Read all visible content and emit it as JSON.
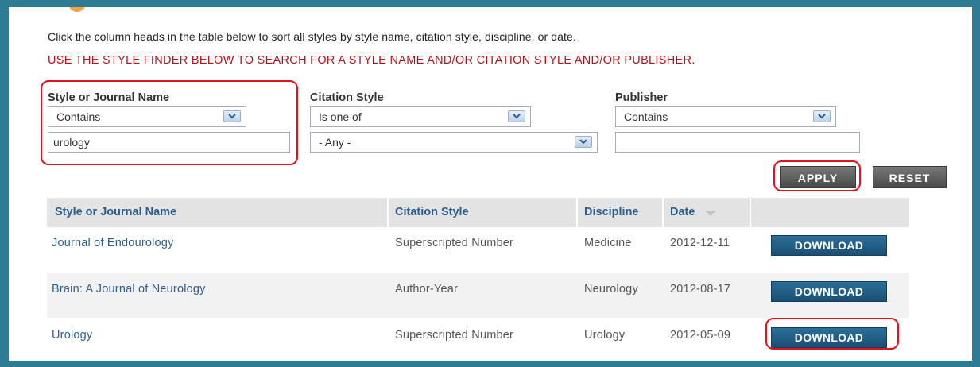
{
  "intro_text": "Click the column heads in the table below to sort all styles by style name, citation style, discipline, or date.",
  "finder_note": "USE THE STYLE FINDER BELOW TO SEARCH FOR A STYLE NAME AND/OR CITATION STYLE AND/OR PUBLISHER.",
  "filters": {
    "style_name": {
      "label": "Style or Journal Name",
      "operator": "Contains",
      "value": "urology"
    },
    "citation_style": {
      "label": "Citation Style",
      "operator": "Is one of",
      "value": "- Any -"
    },
    "publisher": {
      "label": "Publisher",
      "operator": "Contains",
      "value": ""
    }
  },
  "buttons": {
    "apply": "APPLY",
    "reset": "RESET"
  },
  "table": {
    "headers": [
      "Style or Journal Name",
      "Citation Style",
      "Discipline",
      "Date"
    ],
    "rows": [
      {
        "name": "Journal of Endourology",
        "citation": "Superscripted Number",
        "discipline": "Medicine",
        "date": "2012-12-11",
        "action": "DOWNLOAD"
      },
      {
        "name": "Brain: A Journal of Neurology",
        "citation": "Author-Year",
        "discipline": "Neurology",
        "date": "2012-08-17",
        "action": "DOWNLOAD"
      },
      {
        "name": "Urology",
        "citation": "Superscripted Number",
        "discipline": "Urology",
        "date": "2012-05-09",
        "action": "DOWNLOAD"
      }
    ]
  },
  "colors": {
    "frame": "#2e7c93",
    "highlight": "#e0121e",
    "link": "#2d5f8b",
    "note": "#b0141e",
    "download": "#1f5a82"
  },
  "icons": {
    "dropdown": "chevron-down-icon",
    "sort": "sort-desc-icon"
  }
}
